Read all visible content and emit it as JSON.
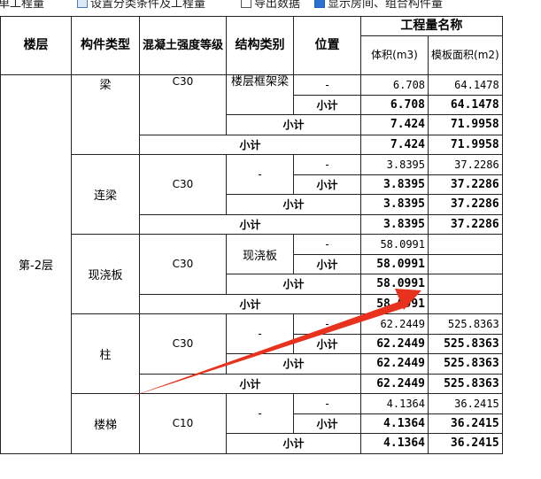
{
  "toolbar": {
    "item1": "单工程量",
    "item2": "设置分类条件及工程量",
    "item3": "导出数据",
    "item4": "显示房间、组合构件量"
  },
  "headers": {
    "floor": "楼层",
    "component_type": "构件类型",
    "concrete_grade": "混凝土强度等级",
    "structure_type": "结构类别",
    "position": "位置",
    "quantity_name": "工程量名称",
    "volume": "体积(m3)",
    "formwork_area": "模板面积(m2)"
  },
  "floor": "第-2层",
  "groups": {
    "beam": {
      "type": "梁",
      "grade": "C30",
      "structure": "楼层框架梁",
      "row_pos": "-",
      "row_vol": "6.708",
      "row_area": "64.1478",
      "sub_label": "小计",
      "sub_vol": "6.708",
      "sub_area": "64.1478",
      "grade_sub_label": "小计",
      "grade_sub_vol": "7.424",
      "grade_sub_area": "71.9958",
      "type_sub_label": "小计",
      "type_sub_vol": "7.424",
      "type_sub_area": "71.9958"
    },
    "coupling_beam": {
      "type": "连梁",
      "grade": "C30",
      "structure": "-",
      "row_pos": "-",
      "row_vol": "3.8395",
      "row_area": "37.2286",
      "sub_label": "小计",
      "sub_vol": "3.8395",
      "sub_area": "37.2286",
      "grade_sub_label": "小计",
      "grade_sub_vol": "3.8395",
      "grade_sub_area": "37.2286",
      "type_sub_label": "小计",
      "type_sub_vol": "3.8395",
      "type_sub_area": "37.2286"
    },
    "cast_slab": {
      "type": "现浇板",
      "grade": "C30",
      "structure": "现浇板",
      "row_pos": "-",
      "row_vol": "58.0991",
      "row_area": "",
      "sub_label": "小计",
      "sub_vol": "58.0991",
      "sub_area": "",
      "grade_sub_label": "小计",
      "grade_sub_vol": "58.0991",
      "grade_sub_area": "",
      "type_sub_label": "小计",
      "type_sub_vol": "58.0991",
      "type_sub_area": ""
    },
    "column": {
      "type": "柱",
      "grade": "C30",
      "structure": "-",
      "row_pos": "-",
      "row_vol": "62.2449",
      "row_area": "525.8363",
      "sub_label": "小计",
      "sub_vol": "62.2449",
      "sub_area": "525.8363",
      "grade_sub_label": "小计",
      "grade_sub_vol": "62.2449",
      "grade_sub_area": "525.8363",
      "type_sub_label": "小计",
      "type_sub_vol": "62.2449",
      "type_sub_area": "525.8363"
    },
    "stair": {
      "type": "楼梯",
      "grade": "C10",
      "structure": "-",
      "row_pos": "-",
      "row_vol": "4.1364",
      "row_area": "36.2415",
      "sub_label": "小计",
      "sub_vol": "4.1364",
      "sub_area": "36.2415",
      "grade_sub_label": "小计",
      "grade_sub_vol": "4.1364",
      "grade_sub_area": "36.2415"
    }
  },
  "colors": {
    "arrow": "#e8321e",
    "border": "#222222"
  },
  "icons": [
    "settings-icon",
    "checkbox-icon",
    "checkbox-checked-icon",
    "red-arrow-annotation"
  ]
}
